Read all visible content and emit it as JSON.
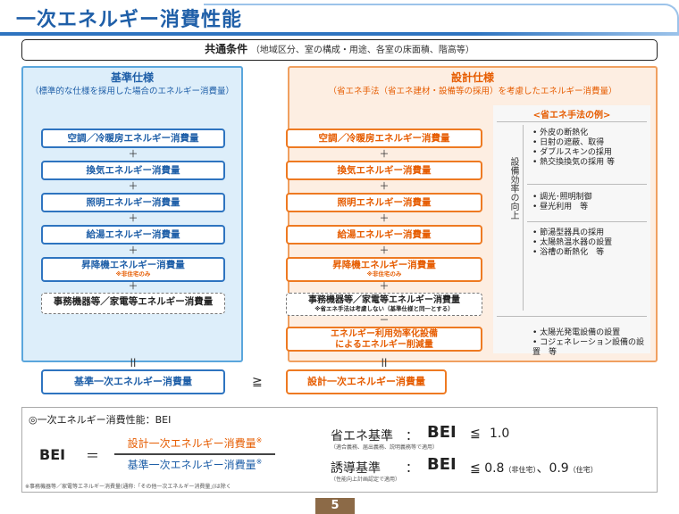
{
  "title": "一次エネルギー消費性能",
  "common": {
    "label": "共通条件",
    "detail": "（地域区分、室の構成・用途、各室の床面積、階高等）"
  },
  "base": {
    "heading": "基準仕様",
    "sub": "（標準的な仕様を採用した場合のエネルギー消費量）",
    "items": [
      "空調／冷暖房エネルギー消費量",
      "換気エネルギー消費量",
      "照明エネルギー消費量",
      "給湯エネルギー消費量",
      "昇降機エネルギー消費量"
    ],
    "elevator_note": "※非住宅のみ",
    "office": "事務機器等／家電等エネルギー消費量",
    "total": "基準一次エネルギー消費量"
  },
  "design": {
    "heading": "設計仕様",
    "sub": "（省エネ手法（省エネ建材・設備等の採用）を考慮したエネルギー消費量）",
    "items": [
      "空調／冷暖房エネルギー消費量",
      "換気エネルギー消費量",
      "照明エネルギー消費量",
      "給湯エネルギー消費量",
      "昇降機エネルギー消費量"
    ],
    "elevator_note": "※非住宅のみ",
    "office": "事務機器等／家電等エネルギー消費量",
    "office_note": "※省エネ手法は考慮しない（基準仕様と同一とする）",
    "reduction_l1": "エネルギー利用効率化設備",
    "reduction_l2": "によるエネルギー削減量",
    "total": "設計一次エネルギー消費量"
  },
  "ops": {
    "plus": "＋",
    "minus": "－",
    "equals": "ll",
    "ge": "≧"
  },
  "examples": {
    "heading": "<省エネ手法の例>",
    "vertical": "設備効率の向上",
    "group1": [
      "外皮の断熱化",
      "日射の遮蔽、取得",
      "ダブルスキンの採用",
      "熱交換換気の採用 等"
    ],
    "group2": [
      "調光･照明制御",
      "昼光利用　等"
    ],
    "group3": [
      "節湯型器具の採用",
      "太陽熱温水器の設置",
      "浴槽の断熱化　等"
    ],
    "group4": [
      "太陽光発電設備の設置",
      "コジェネレーション設備の設置　等"
    ]
  },
  "bei": {
    "heading": "◎一次エネルギー消費性能：BEI",
    "label": "BEI",
    "equals": "＝",
    "numerator": "設計一次エネルギー消費量",
    "denominator": "基準一次エネルギー消費量",
    "mark": "※",
    "footnote": "※事務機器等／家電等エネルギー消費量(通称:「その他一次エネルギー消費量」)は除く",
    "std1_label": "省エネ基準",
    "std1_sub": "（適合義務、届出義務、説明義務等で適用）",
    "std1_value": "1.0",
    "std2_label": "誘導基準",
    "std2_sub": "（性能向上計画認定で適用）",
    "std2_value1": "0.8",
    "std2_tag1": "（非住宅）",
    "std2_sep": "、",
    "std2_value2": "0.9",
    "std2_tag2": "（住宅）",
    "colon": "：",
    "le": "≦"
  },
  "page": "5",
  "colors": {
    "blue": "#1f5fa8",
    "orange": "#e65c00"
  }
}
